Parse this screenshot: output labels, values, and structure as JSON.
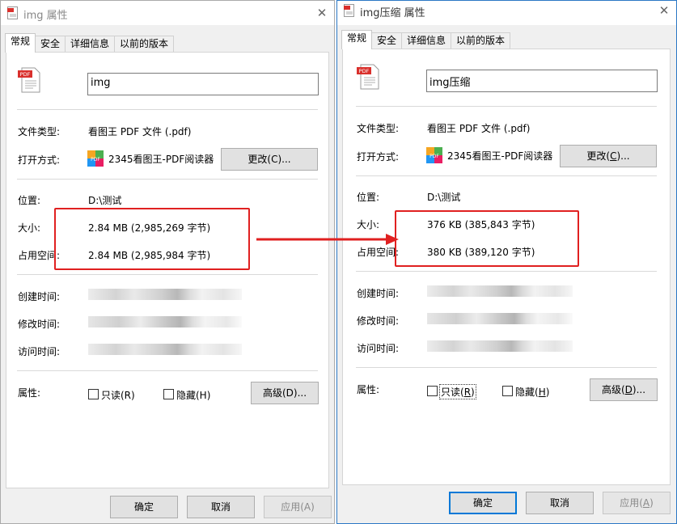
{
  "left": {
    "title": "img 属性",
    "tabs": [
      "常规",
      "安全",
      "详细信息",
      "以前的版本"
    ],
    "name_value": "img",
    "file_type_label": "文件类型:",
    "file_type_value": "看图王 PDF 文件 (.pdf)",
    "open_with_label": "打开方式:",
    "open_with_value": "2345看图王-PDF阅读器",
    "change_label": "更改(C)...",
    "location_label": "位置:",
    "location_value": "D:\\测试",
    "size_label": "大小:",
    "size_value": "2.84 MB (2,985,269 字节)",
    "disk_label": "占用空间:",
    "disk_value": "2.84 MB (2,985,984 字节)",
    "created_label": "创建时间:",
    "modified_label": "修改时间:",
    "accessed_label": "访问时间:",
    "attrs_label": "属性:",
    "readonly_label": "只读(R)",
    "hidden_label": "隐藏(H)",
    "advanced_label": "高级(D)...",
    "ok_label": "确定",
    "cancel_label": "取消",
    "apply_label": "应用(A)"
  },
  "right": {
    "title": "img压缩 属性",
    "tabs": [
      "常规",
      "安全",
      "详细信息",
      "以前的版本"
    ],
    "name_value": "img压缩",
    "file_type_label": "文件类型:",
    "file_type_value": "看图王 PDF 文件 (.pdf)",
    "open_with_label": "打开方式:",
    "open_with_value": "2345看图王-PDF阅读器",
    "change_label_pre": "更改(",
    "change_label_key": "C",
    "change_label_post": ")...",
    "location_label": "位置:",
    "location_value": "D:\\测试",
    "size_label": "大小:",
    "size_value": "376 KB (385,843 字节)",
    "disk_label": "占用空间:",
    "disk_value": "380 KB (389,120 字节)",
    "created_label": "创建时间:",
    "modified_label": "修改时间:",
    "accessed_label": "访问时间:",
    "attrs_label": "属性:",
    "readonly_label_pre": "只读(",
    "readonly_label_key": "R",
    "readonly_label_post": ")",
    "hidden_label_pre": "隐藏(",
    "hidden_label_key": "H",
    "hidden_label_post": ")",
    "advanced_label_pre": "高级(",
    "advanced_label_key": "D",
    "advanced_label_post": ")...",
    "ok_label": "确定",
    "cancel_label": "取消",
    "apply_label_pre": "应用(",
    "apply_label_key": "A",
    "apply_label_post": ")"
  },
  "icons": {
    "pdf_badge_text": "PDF",
    "app_badge_text": "PDF",
    "close_glyph": "✕"
  },
  "colors": {
    "highlight_red": "#e02020",
    "accent_blue": "#0078d7"
  }
}
